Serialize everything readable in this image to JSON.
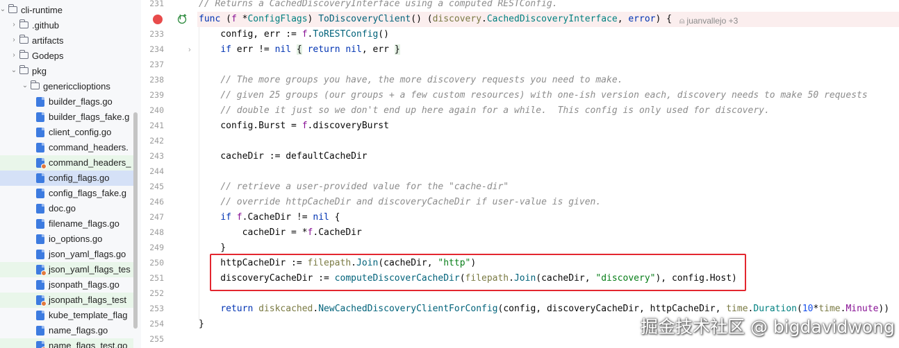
{
  "tree": {
    "items": [
      {
        "label": "cli-runtime",
        "kind": "folder",
        "depth": 0,
        "open": true
      },
      {
        "label": ".github",
        "kind": "folder",
        "depth": 1,
        "open": false
      },
      {
        "label": "artifacts",
        "kind": "folder",
        "depth": 1,
        "open": false
      },
      {
        "label": "Godeps",
        "kind": "folder",
        "depth": 1,
        "open": false
      },
      {
        "label": "pkg",
        "kind": "folder",
        "depth": 1,
        "open": true
      },
      {
        "label": "genericclioptions",
        "kind": "folder",
        "depth": 2,
        "open": true
      },
      {
        "label": "builder_flags.go",
        "kind": "go",
        "depth": 3
      },
      {
        "label": "builder_flags_fake.g",
        "kind": "go",
        "depth": 3
      },
      {
        "label": "client_config.go",
        "kind": "go",
        "depth": 3
      },
      {
        "label": "command_headers.",
        "kind": "go",
        "depth": 3
      },
      {
        "label": "command_headers_",
        "kind": "gotest",
        "depth": 3
      },
      {
        "label": "config_flags.go",
        "kind": "go",
        "depth": 3,
        "selected": true
      },
      {
        "label": "config_flags_fake.g",
        "kind": "go",
        "depth": 3
      },
      {
        "label": "doc.go",
        "kind": "go",
        "depth": 3
      },
      {
        "label": "filename_flags.go",
        "kind": "go",
        "depth": 3
      },
      {
        "label": "io_options.go",
        "kind": "go",
        "depth": 3
      },
      {
        "label": "json_yaml_flags.go",
        "kind": "go",
        "depth": 3
      },
      {
        "label": "json_yaml_flags_tes",
        "kind": "gotest",
        "depth": 3
      },
      {
        "label": "jsonpath_flags.go",
        "kind": "go",
        "depth": 3
      },
      {
        "label": "jsonpath_flags_test",
        "kind": "gotest",
        "depth": 3
      },
      {
        "label": "kube_template_flag",
        "kind": "go",
        "depth": 3
      },
      {
        "label": "name_flags.go",
        "kind": "go",
        "depth": 3
      },
      {
        "label": "name_flags_test.go",
        "kind": "gotest",
        "depth": 3
      }
    ]
  },
  "editor": {
    "author_hint": "juanvallejo +3",
    "lines": [
      {
        "n": "231",
        "html": "<span class=\"c\">// Returns a CachedDiscoveryInterface using a computed RESTConfig.</span>"
      },
      {
        "n": "",
        "hl": true,
        "html": "<span class=\"k\">func</span> (<span class=\"o\">f</span> *<span class=\"t\">ConfigFlags</span>) <span class=\"f\">ToDiscoveryClient</span>() (<span class=\"pkg\">discovery</span>.<span class=\"t\">CachedDiscoveryInterface</span>, <span class=\"k\">error</span>) {"
      },
      {
        "n": "233",
        "html": "    config, err := <span class=\"o\">f</span>.<span class=\"f\">ToRESTConfig</span>()"
      },
      {
        "n": "234",
        "html": "    <span class=\"k\">if</span> err != <span class=\"k\">nil</span> <span class=\"brk\">{</span> <span class=\"k\">return</span> <span class=\"k\">nil</span>, err <span class=\"brk\">}</span>"
      },
      {
        "n": "237",
        "html": ""
      },
      {
        "n": "238",
        "html": "    <span class=\"c\">// The more groups you have, the more discovery requests you need to make.</span>"
      },
      {
        "n": "239",
        "html": "    <span class=\"c\">// given 25 groups (our groups + a few custom resources) with one-ish version each, discovery needs to make 50 requests</span>"
      },
      {
        "n": "240",
        "html": "    <span class=\"c\">// double it just so we don't end up here again for a while.  This config is only used for discovery.</span>"
      },
      {
        "n": "241",
        "html": "    config.Burst = <span class=\"o\">f</span>.discoveryBurst"
      },
      {
        "n": "242",
        "html": ""
      },
      {
        "n": "243",
        "html": "    cacheDir := defaultCacheDir"
      },
      {
        "n": "244",
        "html": ""
      },
      {
        "n": "245",
        "html": "    <span class=\"c\">// retrieve a user-provided value for the \"cache-dir\"</span>"
      },
      {
        "n": "246",
        "html": "    <span class=\"c\">// override httpCacheDir and discoveryCacheDir if user-value is given.</span>"
      },
      {
        "n": "247",
        "html": "    <span class=\"k\">if</span> <span class=\"o\">f</span>.CacheDir != <span class=\"k\">nil</span> {"
      },
      {
        "n": "248",
        "html": "        cacheDir = *<span class=\"o\">f</span>.CacheDir"
      },
      {
        "n": "249",
        "html": "    }"
      },
      {
        "n": "250",
        "html": "    httpCacheDir := <span class=\"pkg\">filepath</span>.<span class=\"f\">Join</span>(cacheDir, <span class=\"s\">\"http\"</span>)"
      },
      {
        "n": "251",
        "html": "    discoveryCacheDir := <span class=\"f\">computeDiscoverCacheDir</span>(<span class=\"pkg\">filepath</span>.<span class=\"f\">Join</span>(cacheDir, <span class=\"s\">\"discovery\"</span>), config.Host)"
      },
      {
        "n": "252",
        "html": ""
      },
      {
        "n": "253",
        "html": "    <span class=\"k\">return</span> <span class=\"pkg\">diskcached</span>.<span class=\"f\">NewCachedDiscoveryClientForConfig</span>(config, discoveryCacheDir, httpCacheDir, <span class=\"pkg\">time</span>.<span class=\"t\">Duration</span>(<span class=\"n\">10</span>*<span class=\"pkg\">time</span>.<span class=\"o\">Minute</span>))"
      },
      {
        "n": "254",
        "html": "}"
      },
      {
        "n": "255",
        "html": ""
      }
    ]
  },
  "watermark": "掘金技术社区 @ bigdavidwong",
  "colors": {
    "keyword": "#0033b3",
    "comment": "#8c8c8c",
    "string": "#067d17",
    "function": "#00627a",
    "highlight_box": "#e3262f",
    "breakpoint": "#e84b4b"
  }
}
